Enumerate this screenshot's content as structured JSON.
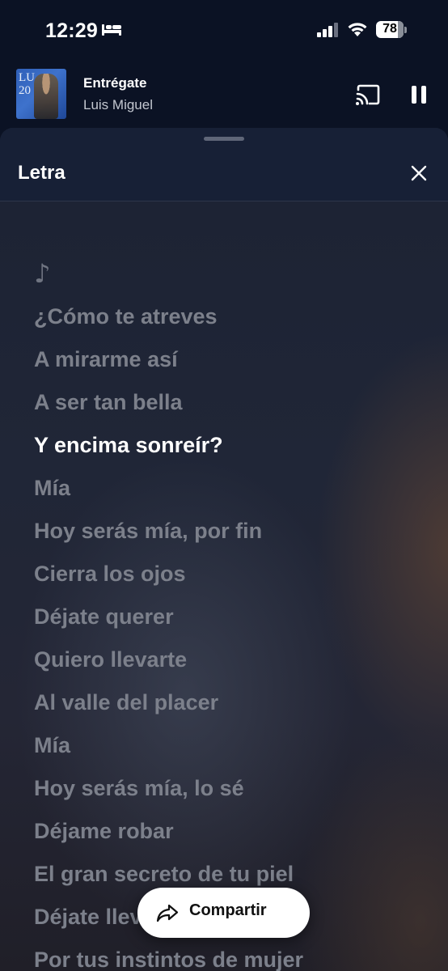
{
  "status_bar": {
    "time": "12:29",
    "battery": "78",
    "icons": [
      "bed-icon",
      "cellular-signal-icon",
      "wifi-icon",
      "battery-icon"
    ]
  },
  "now_playing": {
    "title": "Entrégate",
    "artist": "Luis Miguel",
    "album_art_text": "LUIS 20",
    "icons": [
      "cast-icon",
      "pause-icon"
    ]
  },
  "sheet": {
    "title": "Letra",
    "icons": [
      "close-icon",
      "music-note-icon"
    ]
  },
  "lyrics": {
    "music_note": "♪",
    "active_index": 3,
    "lines": [
      "¿Cómo te atreves",
      "A mirarme así",
      "A ser tan bella",
      "Y encima sonreír?",
      "Mía",
      "Hoy serás mía, por fin",
      "Cierra los ojos",
      "Déjate querer",
      "Quiero llevarte",
      "Al valle del placer",
      "Mía",
      "Hoy serás mía, lo sé",
      "Déjame robar",
      "El gran secreto de tu piel",
      "Déjate llevar",
      "Por tus instintos de mujer"
    ]
  },
  "share": {
    "label": "Compartir",
    "icon": "share-arrow-icon"
  },
  "colors": {
    "lyric_active": "#ffffff",
    "lyric_inactive": "#7c808b",
    "sheet_header": "#172036"
  }
}
